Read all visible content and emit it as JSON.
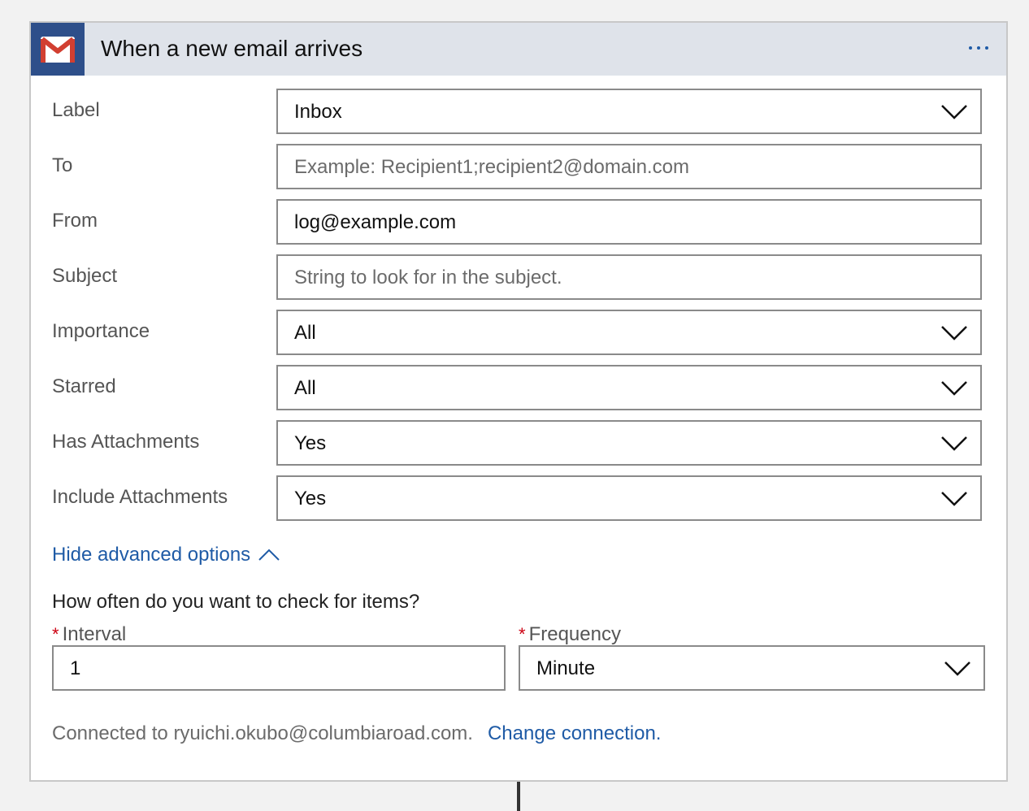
{
  "header": {
    "title": "When a new email arrives",
    "icon": "gmail-icon",
    "more_icon": "more-icon"
  },
  "fields": [
    {
      "label": "Label",
      "type": "select",
      "value": "Inbox",
      "placeholder": ""
    },
    {
      "label": "To",
      "type": "text",
      "value": "",
      "placeholder": "Example: Recipient1;recipient2@domain.com"
    },
    {
      "label": "From",
      "type": "text",
      "value": "log@example.com",
      "placeholder": ""
    },
    {
      "label": "Subject",
      "type": "text",
      "value": "",
      "placeholder": "String to look for in the subject."
    },
    {
      "label": "Importance",
      "type": "select",
      "value": "All",
      "placeholder": ""
    },
    {
      "label": "Starred",
      "type": "select",
      "value": "All",
      "placeholder": ""
    },
    {
      "label": "Has Attachments",
      "type": "select",
      "value": "Yes",
      "placeholder": ""
    },
    {
      "label": "Include Attachments",
      "type": "select",
      "value": "Yes",
      "placeholder": ""
    }
  ],
  "advanced": {
    "toggle_label": "Hide advanced options"
  },
  "recurrence": {
    "question": "How often do you want to check for items?",
    "required_marker": "*",
    "interval_label": "Interval",
    "interval_value": "1",
    "frequency_label": "Frequency",
    "frequency_value": "Minute"
  },
  "connection": {
    "text": "Connected to ryuichi.okubo@columbiaroad.com.",
    "change_label": "Change connection."
  },
  "colors": {
    "accent": "#1f5ba6",
    "header_bg": "#dfe3ea",
    "gmail_tile": "#2e4f8a",
    "required": "#cc0011"
  }
}
